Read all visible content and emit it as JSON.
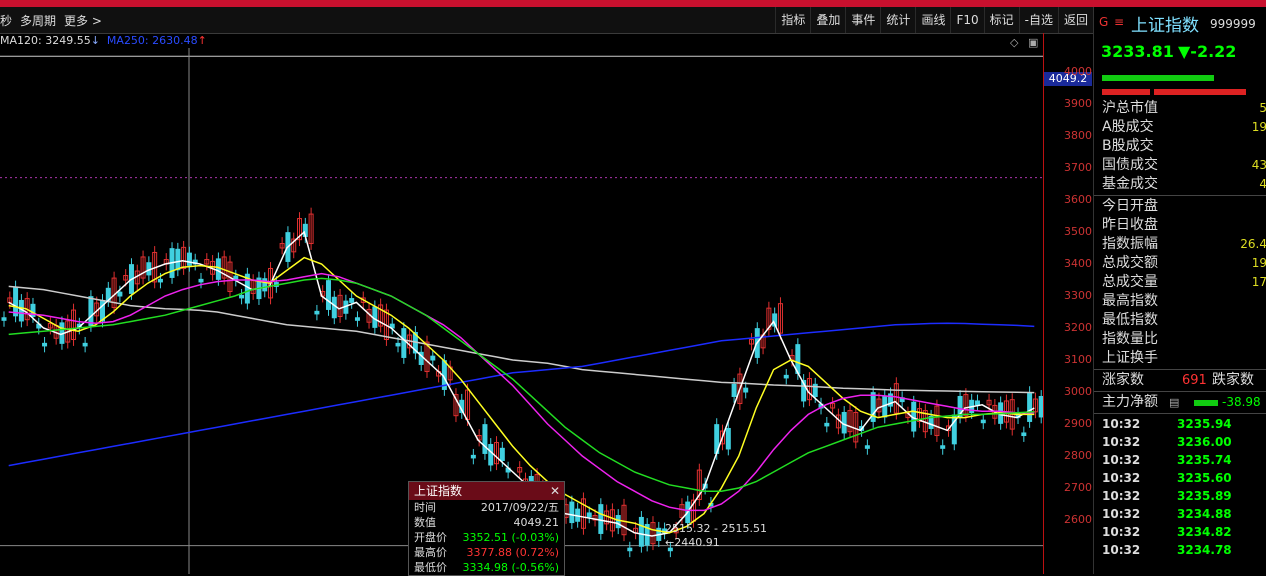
{
  "toolbar": {
    "left_items": [
      "秒",
      "多周期",
      "更多 >"
    ],
    "buttons": [
      "指标",
      "叠加",
      "事件",
      "统计",
      "画线",
      "F10",
      "标记",
      "-自选",
      "返回"
    ]
  },
  "ma_line": {
    "ma120": "MA120: 3249.55",
    "ma120_arrow": "↓",
    "ma250": "MA250: 2630.48",
    "ma250_arrow": "↑"
  },
  "y_axis": {
    "current": "4049.2",
    "ticks": [
      "4000",
      "3900",
      "3800",
      "3700",
      "3600",
      "3500",
      "3400",
      "3300",
      "3200",
      "3100",
      "3000",
      "2900",
      "2800",
      "2700",
      "2600"
    ]
  },
  "popup": {
    "title": "上证指数",
    "rows": [
      {
        "k": "时间",
        "v": "2017/09/22/五",
        "color": "#ddd"
      },
      {
        "k": "数值",
        "v": "4049.21",
        "color": "#ddd"
      },
      {
        "k": "开盘价",
        "v": "3352.51 (-0.03%)",
        "color": "#0f0"
      },
      {
        "k": "最高价",
        "v": "3377.88 (0.72%)",
        "color": "#f33"
      },
      {
        "k": "最低价",
        "v": "3334.98 (-0.56%)",
        "color": "#0f0"
      }
    ]
  },
  "low_label": "2515.32 - 2515.51",
  "low_label2": "←2440.91",
  "panel": {
    "g": "G",
    "menu": "≡",
    "name": "上证指数",
    "code": "999999",
    "price": "3233.81",
    "change": "▼-2.22",
    "stats": [
      {
        "k": "沪总市值",
        "v": "5"
      },
      {
        "k": "A股成交",
        "v": "19"
      },
      {
        "k": "B股成交",
        "v": ""
      },
      {
        "k": "国债成交",
        "v": "43"
      },
      {
        "k": "基金成交",
        "v": "4"
      },
      {
        "k": "今日开盘",
        "v": ""
      },
      {
        "k": "昨日收盘",
        "v": ""
      },
      {
        "k": "指数振幅",
        "v": "26.4"
      },
      {
        "k": "总成交额",
        "v": "19"
      },
      {
        "k": "总成交量",
        "v": "17"
      },
      {
        "k": "最高指数",
        "v": ""
      },
      {
        "k": "最低指数",
        "v": ""
      },
      {
        "k": "指数量比",
        "v": ""
      },
      {
        "k": "上证换手",
        "v": ""
      }
    ],
    "rise": {
      "label": "涨家数",
      "value": "691",
      "fall_label": "跌家数"
    },
    "main_flow": {
      "label": "主力净额",
      "value": "-38.98"
    },
    "ticks": [
      {
        "t": "10:32",
        "p": "3235.94"
      },
      {
        "t": "10:32",
        "p": "3236.00"
      },
      {
        "t": "10:32",
        "p": "3235.74"
      },
      {
        "t": "10:32",
        "p": "3235.60"
      },
      {
        "t": "10:32",
        "p": "3235.89"
      },
      {
        "t": "10:32",
        "p": "3234.88"
      },
      {
        "t": "10:32",
        "p": "3234.82"
      },
      {
        "t": "10:32",
        "p": "3234.78"
      }
    ]
  },
  "chart_data": {
    "type": "candlestick",
    "ylim": [
      2500,
      4050
    ],
    "lines": [
      {
        "name": "MA120",
        "color": "#cccccc",
        "values": [
          3330,
          3325,
          3320,
          3310,
          3300,
          3290,
          3280,
          3270,
          3265,
          3260,
          3258,
          3255,
          3250,
          3240,
          3230,
          3220,
          3210,
          3205,
          3200,
          3195,
          3190,
          3180,
          3170,
          3160,
          3150,
          3140,
          3130,
          3120,
          3110,
          3100,
          3095,
          3090,
          3080,
          3070,
          3065,
          3060,
          3055,
          3050,
          3045,
          3040,
          3035,
          3030,
          3028,
          3025,
          3022,
          3020,
          3018,
          3015,
          3012,
          3010,
          3008,
          3006,
          3005,
          3004,
          3003,
          3002,
          3001,
          3000,
          2999,
          2998
        ]
      },
      {
        "name": "MA250",
        "color": "#1c2cff",
        "values": [
          2770,
          2780,
          2790,
          2800,
          2810,
          2820,
          2830,
          2840,
          2850,
          2860,
          2870,
          2880,
          2890,
          2900,
          2910,
          2920,
          2930,
          2940,
          2950,
          2960,
          2970,
          2980,
          2990,
          3000,
          3010,
          3020,
          3030,
          3040,
          3050,
          3060,
          3065,
          3070,
          3075,
          3080,
          3090,
          3100,
          3110,
          3120,
          3130,
          3140,
          3150,
          3160,
          3165,
          3170,
          3175,
          3180,
          3185,
          3190,
          3195,
          3200,
          3205,
          3210,
          3212,
          3214,
          3215,
          3214,
          3212,
          3210,
          3208,
          3205
        ]
      },
      {
        "name": "MA5",
        "color": "#ffffff",
        "values": [
          3280,
          3250,
          3200,
          3180,
          3200,
          3250,
          3300,
          3350,
          3380,
          3400,
          3410,
          3400,
          3380,
          3350,
          3320,
          3330,
          3450,
          3500,
          3300,
          3260,
          3280,
          3230,
          3200,
          3150,
          3100,
          3050,
          2950,
          2850,
          2800,
          2750,
          2700,
          2650,
          2620,
          2610,
          2600,
          2590,
          2560,
          2550,
          2560,
          2620,
          2700,
          2850,
          3000,
          3150,
          3220,
          3100,
          3000,
          2950,
          2900,
          2880,
          2950,
          2970,
          2920,
          2900,
          2880,
          2950,
          2960,
          2930,
          2920,
          2950
        ]
      },
      {
        "name": "MA10",
        "color": "#ffff22",
        "values": [
          3270,
          3260,
          3230,
          3200,
          3190,
          3210,
          3250,
          3300,
          3340,
          3370,
          3390,
          3395,
          3390,
          3370,
          3350,
          3340,
          3380,
          3420,
          3400,
          3350,
          3300,
          3270,
          3240,
          3200,
          3150,
          3100,
          3040,
          2970,
          2900,
          2830,
          2770,
          2720,
          2680,
          2650,
          2620,
          2600,
          2590,
          2570,
          2560,
          2580,
          2620,
          2700,
          2800,
          2950,
          3070,
          3100,
          3080,
          3030,
          2980,
          2940,
          2920,
          2930,
          2940,
          2930,
          2920,
          2920,
          2930,
          2935,
          2930,
          2930
        ]
      },
      {
        "name": "MA20",
        "color": "#ee22ee",
        "values": [
          3250,
          3245,
          3240,
          3230,
          3220,
          3215,
          3220,
          3240,
          3270,
          3300,
          3320,
          3335,
          3345,
          3350,
          3350,
          3345,
          3350,
          3360,
          3370,
          3360,
          3340,
          3320,
          3300,
          3270,
          3240,
          3210,
          3170,
          3120,
          3070,
          3020,
          2960,
          2900,
          2850,
          2800,
          2760,
          2720,
          2690,
          2660,
          2640,
          2630,
          2630,
          2650,
          2690,
          2750,
          2820,
          2880,
          2930,
          2960,
          2980,
          2990,
          2990,
          2985,
          2975,
          2965,
          2955,
          2945,
          2940,
          2940,
          2935,
          2935
        ]
      },
      {
        "name": "MA60",
        "color": "#22dd22",
        "values": [
          3180,
          3185,
          3190,
          3195,
          3200,
          3205,
          3210,
          3220,
          3230,
          3240,
          3255,
          3270,
          3285,
          3300,
          3320,
          3330,
          3340,
          3350,
          3355,
          3350,
          3340,
          3320,
          3300,
          3270,
          3240,
          3200,
          3160,
          3120,
          3080,
          3040,
          2990,
          2940,
          2890,
          2850,
          2810,
          2780,
          2750,
          2730,
          2710,
          2700,
          2690,
          2690,
          2700,
          2720,
          2750,
          2780,
          2810,
          2830,
          2850,
          2870,
          2890,
          2900,
          2910,
          2920,
          2925,
          2930,
          2930,
          2932,
          2935,
          2938
        ]
      }
    ],
    "markers": {
      "selected_date": "2017/09/22",
      "selected_value": 4049.21,
      "low_range": [
        2515.32,
        2515.51
      ],
      "low": 2440.91
    }
  }
}
